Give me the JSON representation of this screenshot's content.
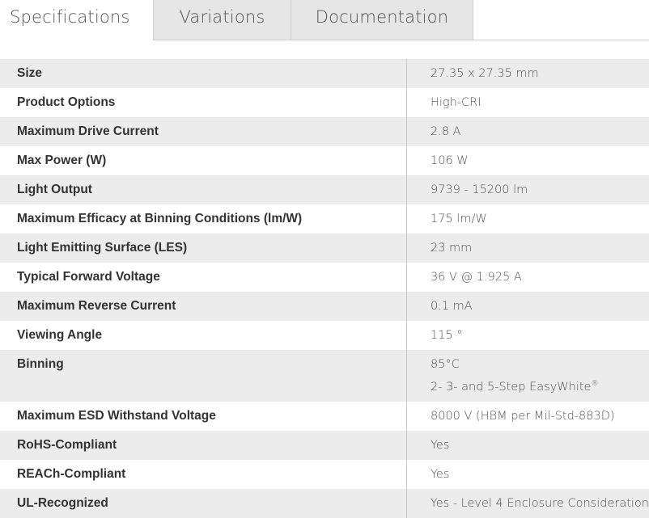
{
  "tabs": [
    {
      "label": "Specifications",
      "active": true
    },
    {
      "label": "Variations",
      "active": false
    },
    {
      "label": "Documentation",
      "active": false
    }
  ],
  "specs": [
    {
      "label": "Size",
      "value": "27.35 x 27.35 mm"
    },
    {
      "label": "Product Options",
      "value": "High-CRI"
    },
    {
      "label": "Maximum Drive Current",
      "value": "2.8 A"
    },
    {
      "label": "Max Power (W)",
      "value": "106 W"
    },
    {
      "label": "Light Output",
      "value": "9739 - 15200 lm"
    },
    {
      "label": "Maximum Efficacy at Binning Conditions (lm/W)",
      "value": "175 lm/W"
    },
    {
      "label": "Light Emitting Surface (LES)",
      "value": "23 mm"
    },
    {
      "label": "Typical Forward Voltage",
      "value": "36 V @ 1.925 A"
    },
    {
      "label": "Maximum Reverse Current",
      "value": "0.1 mA"
    },
    {
      "label": "Viewing Angle",
      "value": "115 °"
    },
    {
      "label": "Binning",
      "value": "85°C",
      "value_line2": "2- 3- and 5-Step EasyWhite",
      "value_line2_sup": "®"
    },
    {
      "label": "Maximum ESD Withstand Voltage",
      "value": "8000 V (HBM per Mil-Std-883D)"
    },
    {
      "label": "RoHS-Compliant",
      "value": "Yes"
    },
    {
      "label": "REACh-Compliant",
      "value": "Yes"
    },
    {
      "label": "UL-Recognized",
      "value": "Yes - Level 4 Enclosure Consideration"
    }
  ]
}
